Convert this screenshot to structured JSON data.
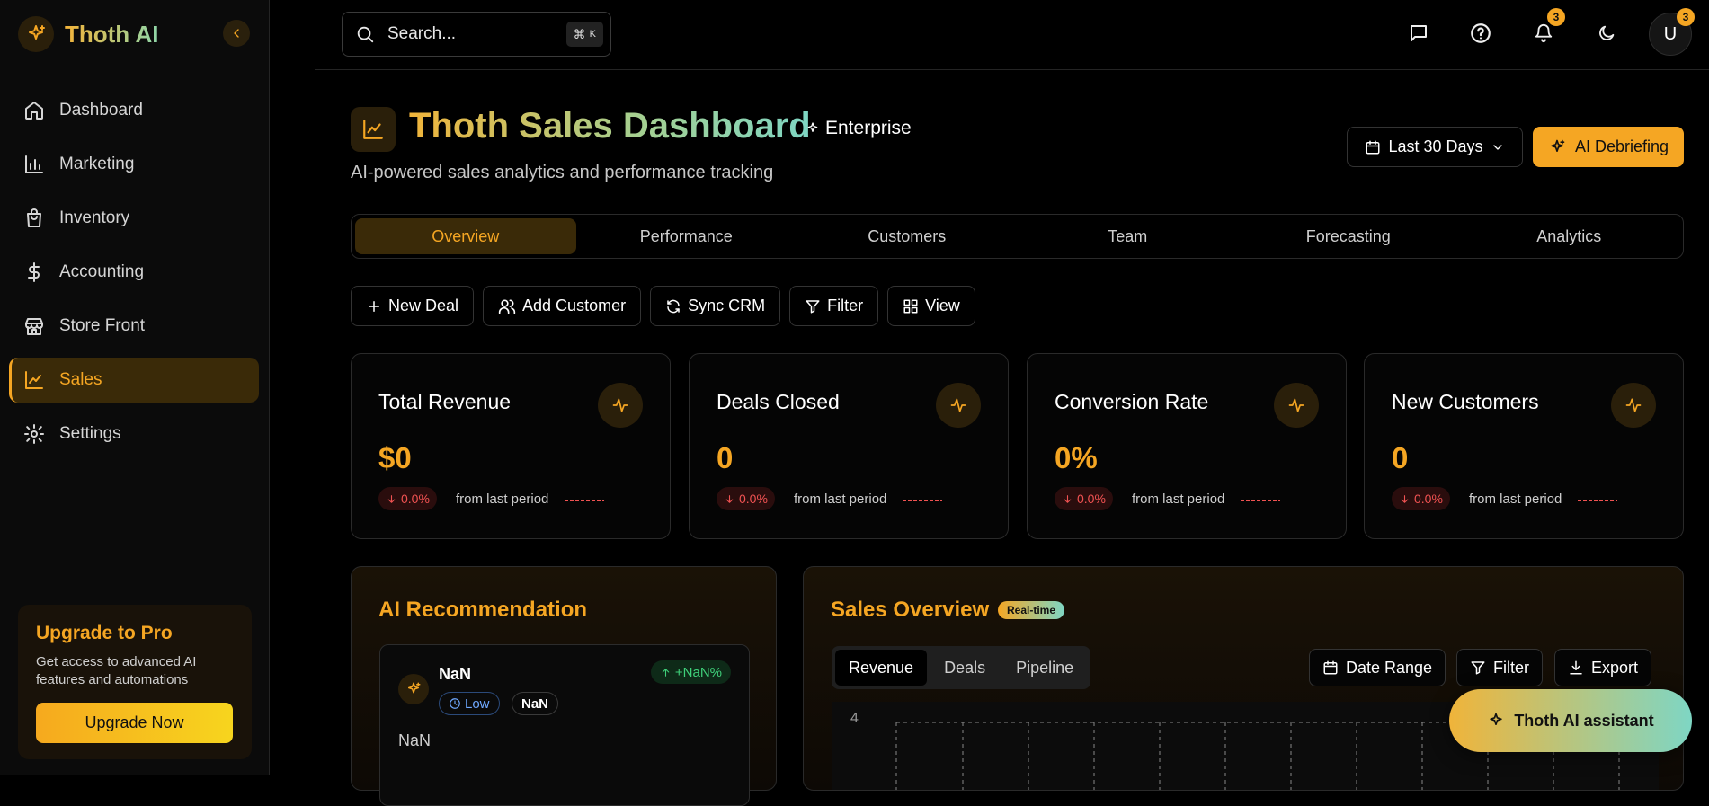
{
  "brand": {
    "name": "Thoth AI"
  },
  "sidebar": {
    "items": [
      {
        "label": "Dashboard",
        "icon": "home-icon"
      },
      {
        "label": "Marketing",
        "icon": "bar-chart-icon"
      },
      {
        "label": "Inventory",
        "icon": "shopping-bag-icon"
      },
      {
        "label": "Accounting",
        "icon": "dollar-icon"
      },
      {
        "label": "Store Front",
        "icon": "store-icon"
      },
      {
        "label": "Sales",
        "icon": "line-chart-icon",
        "active": true
      },
      {
        "label": "Settings",
        "icon": "gear-icon"
      }
    ],
    "upgrade": {
      "title": "Upgrade to Pro",
      "text": "Get access to advanced AI features and automations",
      "button": "Upgrade Now"
    }
  },
  "topbar": {
    "search_placeholder": "Search...",
    "shortcut_symbol": "⌘",
    "shortcut_key": "K",
    "notification_count": "3",
    "avatar_initial": "U",
    "avatar_badge": "3"
  },
  "header": {
    "title": "Thoth Sales Dashboard",
    "edition": "Enterprise",
    "subtitle": "AI-powered sales analytics and performance tracking",
    "date_range": "Last 30 Days",
    "ai_button": "AI Debriefing"
  },
  "tabs": [
    {
      "label": "Overview",
      "active": true
    },
    {
      "label": "Performance"
    },
    {
      "label": "Customers"
    },
    {
      "label": "Team"
    },
    {
      "label": "Forecasting"
    },
    {
      "label": "Analytics"
    }
  ],
  "actions": {
    "new_deal": "New Deal",
    "add_customer": "Add Customer",
    "sync_crm": "Sync CRM",
    "filter": "Filter",
    "view": "View"
  },
  "kpis": [
    {
      "title": "Total Revenue",
      "value": "$0",
      "change": "0.0%",
      "note": "from last period"
    },
    {
      "title": "Deals Closed",
      "value": "0",
      "change": "0.0%",
      "note": "from last period"
    },
    {
      "title": "Conversion Rate",
      "value": "0%",
      "change": "0.0%",
      "note": "from last period"
    },
    {
      "title": "New Customers",
      "value": "0",
      "change": "0.0%",
      "note": "from last period"
    }
  ],
  "recommendation": {
    "section_title": "AI Recommendation",
    "name": "NaN",
    "priority": "Low",
    "tag": "NaN",
    "impact": "+NaN%",
    "description": "NaN"
  },
  "overview": {
    "section_title": "Sales Overview",
    "badge": "Real-time",
    "segments": [
      "Revenue",
      "Deals",
      "Pipeline"
    ],
    "date_range_button": "Date Range",
    "filter_button": "Filter",
    "export_button": "Export",
    "y_tick_top": "4"
  },
  "assistant": {
    "label": "Thoth AI assistant"
  },
  "colors": {
    "accent": "#f5a623",
    "negative": "#f05252",
    "positive": "#3fd07a",
    "teal": "#7ed6c4"
  }
}
